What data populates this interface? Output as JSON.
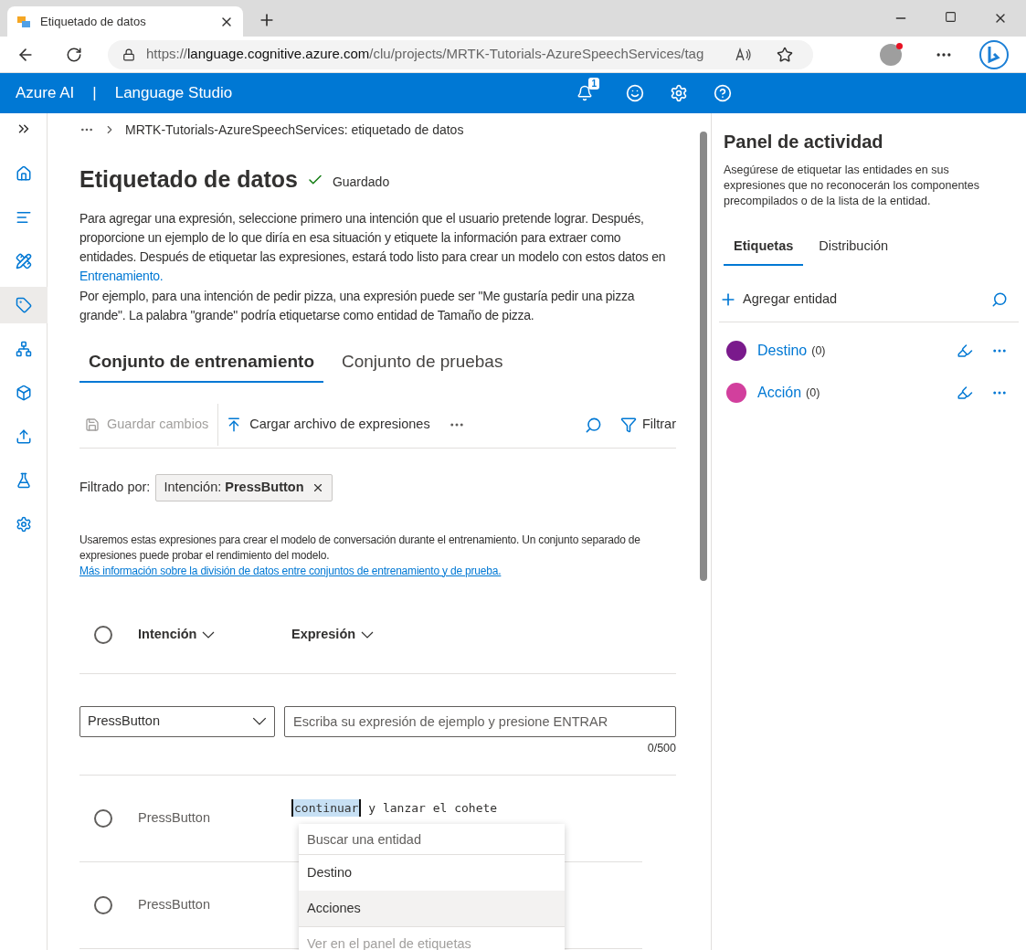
{
  "browser": {
    "tab_title": "Etiquetado de datos",
    "url_scheme": "https://",
    "url_host": "language.cognitive.azure.com",
    "url_path": "/clu/projects/MRTK-Tutorials-AzureSpeechServices/tag"
  },
  "header": {
    "brand": "Azure AI",
    "separator": "|",
    "product": "Language Studio",
    "notification_count": "1"
  },
  "nav": {
    "items": [
      {
        "kind": "home",
        "selected": false
      },
      {
        "kind": "text",
        "selected": false
      },
      {
        "kind": "build",
        "selected": false
      },
      {
        "kind": "tag",
        "selected": true
      },
      {
        "kind": "network",
        "selected": false
      },
      {
        "kind": "cube",
        "selected": false
      },
      {
        "kind": "deploy",
        "selected": false
      },
      {
        "kind": "flask",
        "selected": false
      },
      {
        "kind": "settings",
        "selected": false
      }
    ]
  },
  "breadcrumb": "MRTK-Tutorials-AzureSpeechServices: etiquetado de datos",
  "page": {
    "title": "Etiquetado de datos",
    "status": "Guardado",
    "intro": "Para agregar una expresión, seleccione primero una intención que el usuario pretende lograr. Después, proporcione un ejemplo de lo que diría en esa situación y etiquete la información para extraer como entidades. Después de etiquetar las expresiones, estará todo listo para crear un modelo con estos datos en ",
    "intro_link": "Entrenamiento.",
    "example": "Por ejemplo, para una intención de pedir pizza, una expresión puede ser \"Me gustaría pedir una pizza grande\". La palabra \"grande\" podría etiquetarse como entidad de Tamaño de pizza."
  },
  "tabs": [
    {
      "label": "Conjunto de entrenamiento",
      "selected": true
    },
    {
      "label": "Conjunto de pruebas",
      "selected": false
    }
  ],
  "toolbar": {
    "items": [
      {
        "kind": "save",
        "label": "Guardar cambios",
        "disabled": true
      },
      {
        "kind": "upload",
        "label": "Cargar archivo de expresiones",
        "disabled": false
      }
    ],
    "filter": "Filtrar"
  },
  "filter": {
    "label": "Filtrado por:",
    "chip": "Intención: **PressButton**"
  },
  "info": {
    "text": "Usaremos estas expresiones para crear el modelo de conversación durante el entrenamiento. Un conjunto separado de expresiones puede probar el rendimiento del modelo. ",
    "link": "Más información sobre la división de datos entre conjuntos de entrenamiento y de prueba."
  },
  "table": {
    "select_all": false,
    "columns": [
      "Intención",
      "Expresión"
    ],
    "new_row": {
      "intent": "PressButton",
      "placeholder": "Escriba su expresión de ejemplo y presione ENTRAR",
      "counter": "0/500"
    },
    "rows": [
      {
        "intent": "PressButton",
        "tagged": "continuar",
        "rest": " y lanzar el cohete",
        "selected": false
      },
      {
        "intent": "PressButton",
        "selected": false
      }
    ]
  },
  "entity_menu": {
    "placeholder": "Buscar una entidad",
    "items": [
      {
        "label": "Destino",
        "selected": false
      },
      {
        "label": "Acciones",
        "selected": true
      }
    ],
    "footer": "Ver en el panel de etiquetas"
  },
  "activity": {
    "title": "Panel de actividad",
    "description": "Asegúrese de etiquetar las entidades en sus expresiones que no reconocerán los componentes precompilados o de la lista de la entidad.",
    "tabs": [
      {
        "label": "Etiquetas",
        "selected": true
      },
      {
        "label": "Distribución",
        "selected": false
      }
    ],
    "add": "Agregar entidad",
    "entities": [
      {
        "name": "Destino",
        "count": "(0)",
        "color": "#7a1a8c"
      },
      {
        "name": "Acción",
        "count": "(0)",
        "color": "#d23f9d"
      }
    ]
  }
}
